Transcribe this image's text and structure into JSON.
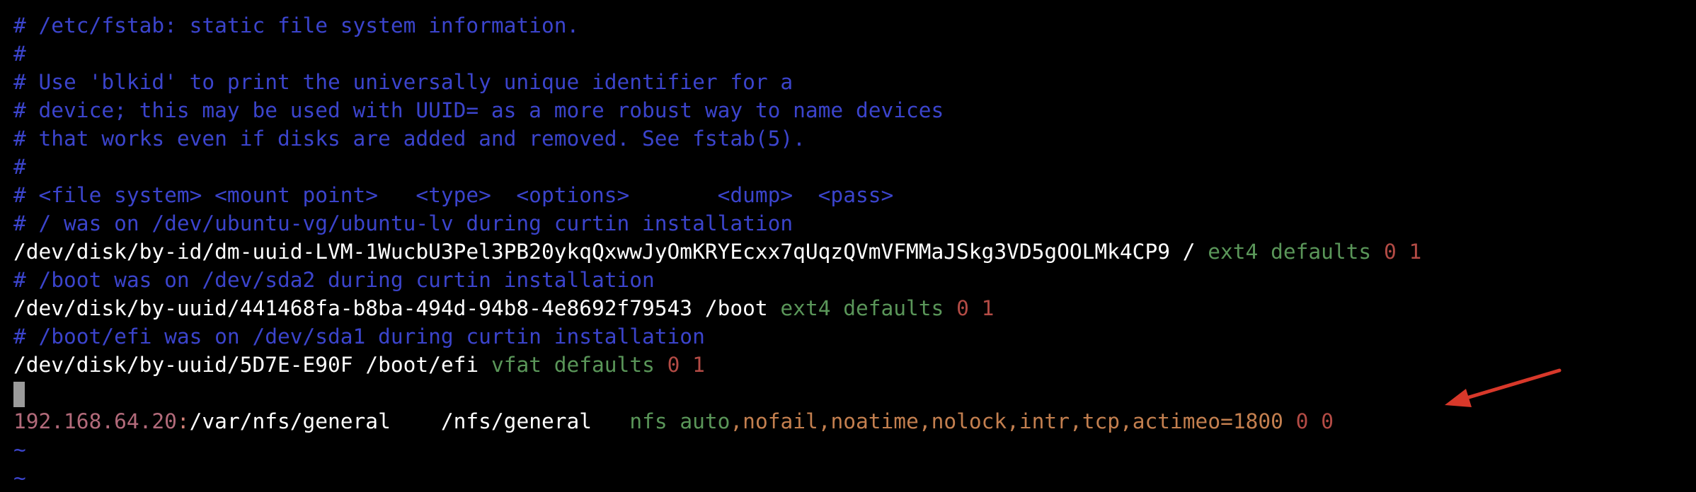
{
  "editor": {
    "lines": {
      "l1": "# /etc/fstab: static file system information.",
      "l2": "#",
      "l3": "# Use 'blkid' to print the universally unique identifier for a",
      "l4": "# device; this may be used with UUID= as a more robust way to name devices",
      "l5": "# that works even if disks are added and removed. See fstab(5).",
      "l6": "#",
      "l7": "# <file system> <mount point>   <type>  <options>       <dump>  <pass>",
      "l8": "# / was on /dev/ubuntu-vg/ubuntu-lv during curtin installation",
      "l10": "# /boot was on /dev/sda2 during curtin installation",
      "l12": "# /boot/efi was on /dev/sda1 during curtin installation"
    },
    "root_entry": {
      "device": "/dev/disk/by-id/dm-uuid-LVM-1WucbU3Pel3PB20ykqQxwwJyOmKRYEcxx7qUqzQVmVFMMaJSkg3VD5gOOLMk4CP9",
      "mount": "/",
      "type": "ext4",
      "options": "defaults",
      "dump": "0",
      "pass": "1"
    },
    "boot_entry": {
      "device": "/dev/disk/by-uuid/441468fa-b8ba-494d-94b8-4e8692f79543",
      "mount": "/boot",
      "type": "ext4",
      "options": "defaults",
      "dump": "0",
      "pass": "1"
    },
    "efi_entry": {
      "device": "/dev/disk/by-uuid/5D7E-E90F",
      "mount": "/boot/efi",
      "type": "vfat",
      "options": "defaults",
      "dump": "0",
      "pass": "1"
    },
    "nfs_entry": {
      "ip": "192.168.64.20",
      "colon": ":",
      "remote_path": "/var/nfs/general",
      "mount": "/nfs/general",
      "type": "nfs",
      "options_auto": "auto",
      "options_rest": ",nofail,noatime,nolock,intr,tcp,actimeo=1800",
      "dump": "0",
      "pass": "0"
    },
    "tilde": "~"
  },
  "colors": {
    "background": "#000000",
    "comment": "#3b44cc",
    "text": "#ffffff",
    "keyword": "#5a9659",
    "number": "#b34b45",
    "arrow": "#d8382a"
  }
}
